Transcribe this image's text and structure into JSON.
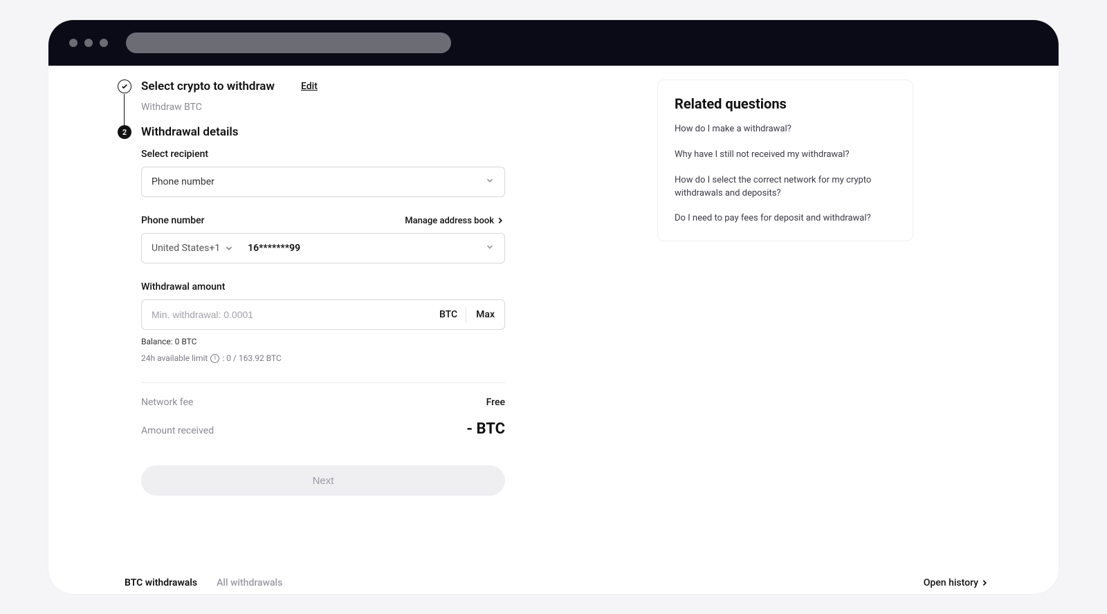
{
  "step1": {
    "title": "Select crypto to withdraw",
    "edit": "Edit",
    "subtitle": "Withdraw BTC"
  },
  "step2": {
    "number": "2",
    "title": "Withdrawal details"
  },
  "recipient": {
    "label": "Select recipient",
    "value": "Phone number"
  },
  "phone": {
    "label": "Phone number",
    "manage": "Manage address book",
    "country": "United States+1",
    "number": "16*******99"
  },
  "amount": {
    "label": "Withdrawal amount",
    "placeholder": "Min. withdrawal: 0.0001",
    "unit": "BTC",
    "max": "Max",
    "balance": "Balance: 0 BTC",
    "limit_prefix": "24h available limit",
    "limit_suffix": ": 0 / 163.92 BTC"
  },
  "summary": {
    "fee_label": "Network fee",
    "fee_value": "Free",
    "recv_label": "Amount received",
    "recv_value": "- BTC"
  },
  "next": "Next",
  "faq": {
    "title": "Related questions",
    "q1": "How do I make a withdrawal?",
    "q2": "Why have I still not received my withdrawal?",
    "q3": "How do I select the correct network for my crypto withdrawals and deposits?",
    "q4": "Do I need to pay fees for deposit and withdrawal?"
  },
  "tabs": {
    "t1": "BTC withdrawals",
    "t2": "All withdrawals",
    "open": "Open history"
  }
}
